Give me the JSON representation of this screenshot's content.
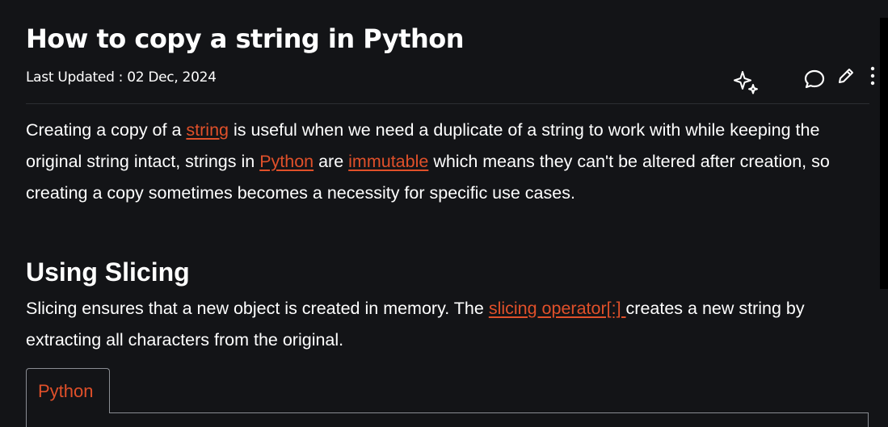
{
  "article": {
    "title": "How to copy a string in Python",
    "last_updated": "Last Updated : 02 Dec, 2024"
  },
  "actions": [
    {
      "icon": "sparkle-icon"
    },
    {
      "icon": "comment-icon"
    },
    {
      "icon": "pencil-icon"
    },
    {
      "icon": "more-vertical-icon"
    }
  ],
  "intro": {
    "t1": "Creating a copy of a ",
    "link1": "string",
    "t2": " is useful when we need a duplicate of a string to work with while keeping the original string intact, strings in ",
    "link2": "Python",
    "t3": " are ",
    "link3": "immutable",
    "t4": " which means they can't be altered after creation, so creating a copy sometimes becomes a necessity for specific use cases."
  },
  "section": {
    "heading": "Using Slicing",
    "t1": "Slicing ensures that a new object is created in memory. The ",
    "link": "slicing operator[:] ",
    "t2": "creates a new string by extracting all characters from the original."
  },
  "code_block": {
    "tab_label": "Python"
  },
  "colors": {
    "background": "#131417",
    "text": "#ffffff",
    "link": "#e0502a",
    "border": "#8a8d93"
  }
}
